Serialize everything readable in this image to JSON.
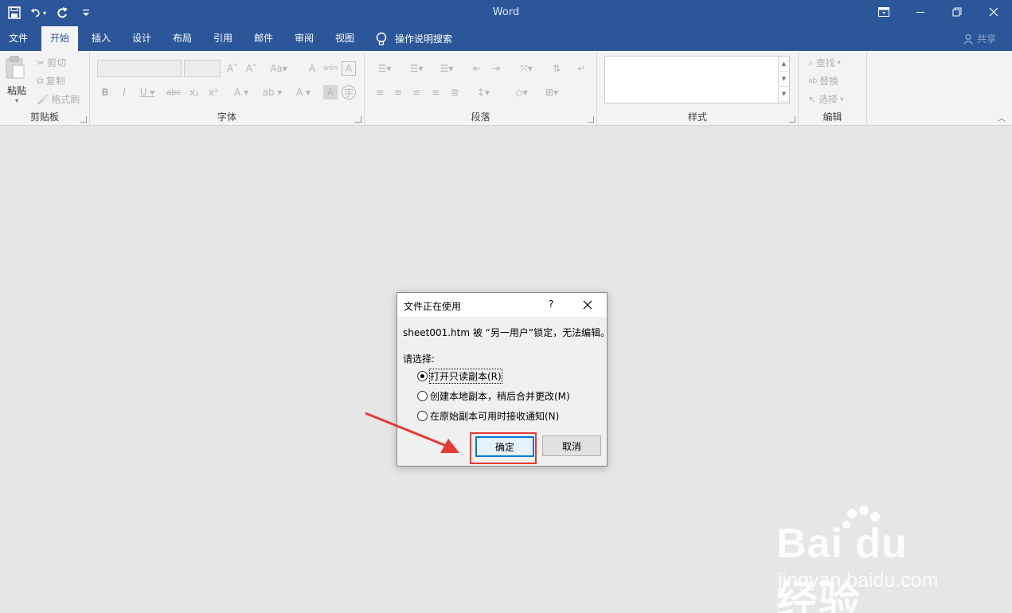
{
  "app": {
    "title": "Word"
  },
  "tabs": [
    "文件",
    "开始",
    "插入",
    "设计",
    "布局",
    "引用",
    "邮件",
    "审阅",
    "视图"
  ],
  "active_tab": "开始",
  "tell_me": "操作说明搜索",
  "share": "共享",
  "ribbon": {
    "clipboard": {
      "label": "剪贴板",
      "paste": "粘贴",
      "cut": "剪切",
      "copy": "复制",
      "format_painter": "格式刷"
    },
    "font": {
      "label": "字体"
    },
    "paragraph": {
      "label": "段落"
    },
    "styles": {
      "label": "样式"
    },
    "editing": {
      "label": "编辑",
      "find": "查找",
      "replace": "替换",
      "select": "选择"
    }
  },
  "dialog": {
    "title": "文件正在使用",
    "help": "?",
    "message": "sheet001.htm 被 “另一用户”锁定，无法编辑。",
    "choose_label": "请选择:",
    "options": [
      {
        "label": "打开只读副本(R)",
        "selected": true
      },
      {
        "label": "创建本地副本，稍后合并更改(M)",
        "selected": false
      },
      {
        "label": "在原始副本可用时接收通知(N)",
        "selected": false
      }
    ],
    "ok": "确定",
    "cancel": "取消"
  },
  "watermark": {
    "brand": "Bai du 经验",
    "url": "jingyan.baidu.com"
  },
  "colors": {
    "titlebar": "#2b579a",
    "ribbon": "#f3f3f3",
    "canvas": "#e6e6e6",
    "highlight": "#e53935"
  }
}
